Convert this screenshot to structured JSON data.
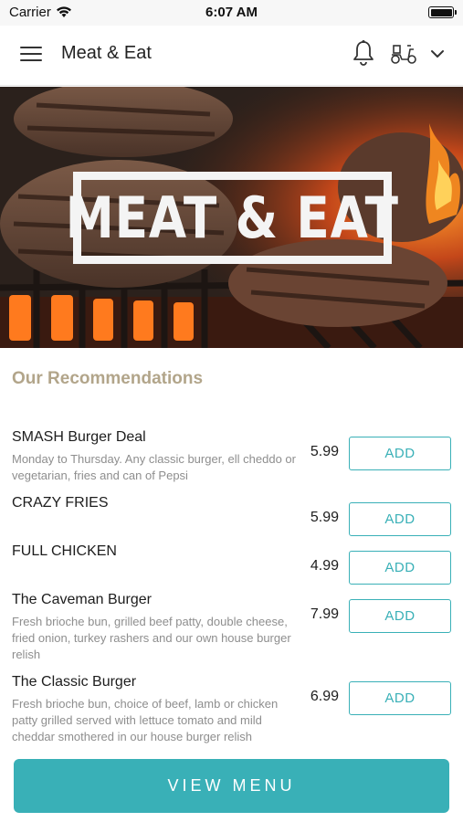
{
  "status_bar": {
    "carrier": "Carrier",
    "time": "6:07 AM"
  },
  "header": {
    "title": "Meat & Eat",
    "icons": [
      "menu-icon",
      "bell-icon",
      "scooter-icon",
      "chevron-down-icon"
    ]
  },
  "hero": {
    "logo_text": "MEAT & EAT"
  },
  "recommendations": {
    "title": "Our Recommendations",
    "add_label": "ADD",
    "items": [
      {
        "name": "SMASH Burger Deal",
        "description": "Monday to Thursday. Any classic burger, ell cheddo or vegetarian, fries and can of Pepsi",
        "price": "5.99"
      },
      {
        "name": "CRAZY FRIES",
        "description": "",
        "price": "5.99"
      },
      {
        "name": "FULL CHICKEN",
        "description": "",
        "price": "4.99"
      },
      {
        "name": "The Caveman Burger",
        "description": "Fresh brioche bun, grilled beef patty, double cheese, fried onion, turkey rashers and our own house burger relish",
        "price": "7.99"
      },
      {
        "name": "The Classic Burger",
        "description": "Fresh brioche bun, choice of beef, lamb or chicken patty grilled served with lettuce tomato and mild cheddar smothered in our house burger relish",
        "price": "6.99"
      }
    ]
  },
  "footer": {
    "view_menu_label": "VIEW MENU"
  },
  "colors": {
    "accent": "#39b0b7",
    "section_title": "#b2a58a",
    "description": "#8e8e8e"
  }
}
